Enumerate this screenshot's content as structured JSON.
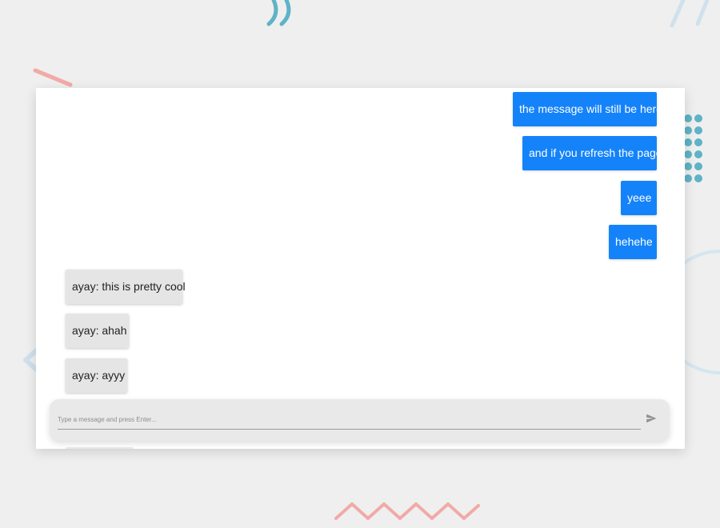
{
  "colors": {
    "background": "#efefef",
    "self_bubble": "#1483fa",
    "other_bubble": "#e5e5e5",
    "composer": "#e9e9ea",
    "deco_teal": "#5fb3c6",
    "deco_pink": "#f2aaa6",
    "deco_light_blue": "#cfe1ec"
  },
  "messages": [
    {
      "from": "self",
      "text": "the message will still be here"
    },
    {
      "from": "self",
      "text": "and if you refresh the page"
    },
    {
      "from": "self",
      "text": "yeee"
    },
    {
      "from": "self",
      "text": "hehehe"
    },
    {
      "from": "other",
      "author": "ayay",
      "text": "this is pretty cool"
    },
    {
      "from": "other",
      "author": "ayay",
      "text": "ahah"
    },
    {
      "from": "other",
      "author": "ayay",
      "text": "ayyy"
    }
  ],
  "composer": {
    "placeholder": "Type a message and press Enter...",
    "value": "",
    "send_icon": "send-icon"
  },
  "decorations": [
    "teal-quote-marks",
    "light-blue-slashes",
    "pink-stroke",
    "teal-dot-grid",
    "light-blue-circle",
    "light-blue-chevron",
    "pink-zigzag"
  ]
}
